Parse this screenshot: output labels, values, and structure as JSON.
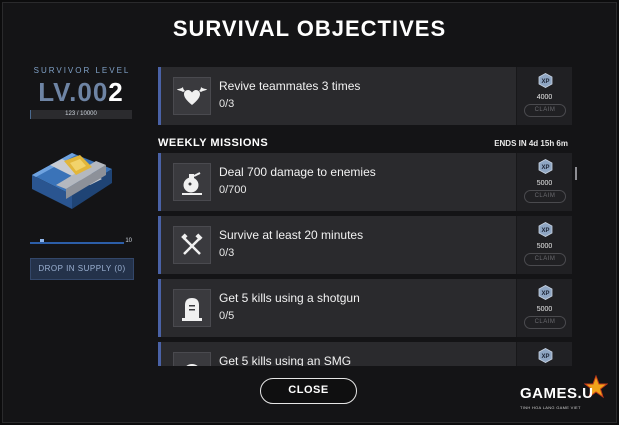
{
  "header": {
    "title": "SURVIVAL OBJECTIVES"
  },
  "left_panel": {
    "level_label": "SURVIVOR LEVEL",
    "level_prefix": "LV.",
    "level_dim": "00",
    "level_bright": "2",
    "xp_text": "123 / 10000",
    "xp_progress": 0.0123,
    "slider_max": "10",
    "drop_button": "DROP IN SUPPLY (0)"
  },
  "daily": {
    "name": "Revive teammates 3 times",
    "progress": "0/3",
    "xp_icon_text": "XP",
    "reward": "4000",
    "claim": "CLAIM",
    "icon": "heart-wings-icon"
  },
  "weekly": {
    "title": "WEEKLY MISSIONS",
    "ends": "ENDS IN 4d 15h 6m",
    "missions": [
      {
        "name": "Deal 700 damage to enemies",
        "progress": "0/700",
        "xp_icon_text": "XP",
        "reward": "5000",
        "claim": "CLAIM",
        "icon": "grenade-icon"
      },
      {
        "name": "Survive at least 20 minutes",
        "progress": "0/3",
        "xp_icon_text": "XP",
        "reward": "5000",
        "claim": "CLAIM",
        "icon": "crossed-tools-icon"
      },
      {
        "name": "Get 5 kills using a shotgun",
        "progress": "0/5",
        "xp_icon_text": "XP",
        "reward": "5000",
        "claim": "CLAIM",
        "icon": "tombstone-icon"
      },
      {
        "name": "Get 5 kills using an SMG",
        "progress": "",
        "xp_icon_text": "XP",
        "reward": "",
        "claim": "",
        "icon": "target-icon"
      }
    ]
  },
  "footer": {
    "close": "CLOSE"
  },
  "watermark": {
    "brand": "GAMES.U",
    "tagline": "TINH HOA LANG GAME VIET"
  },
  "colors": {
    "accent": "#4a62a6",
    "level_dim": "#6e84a4",
    "card_bg": "#2a2a2d"
  }
}
